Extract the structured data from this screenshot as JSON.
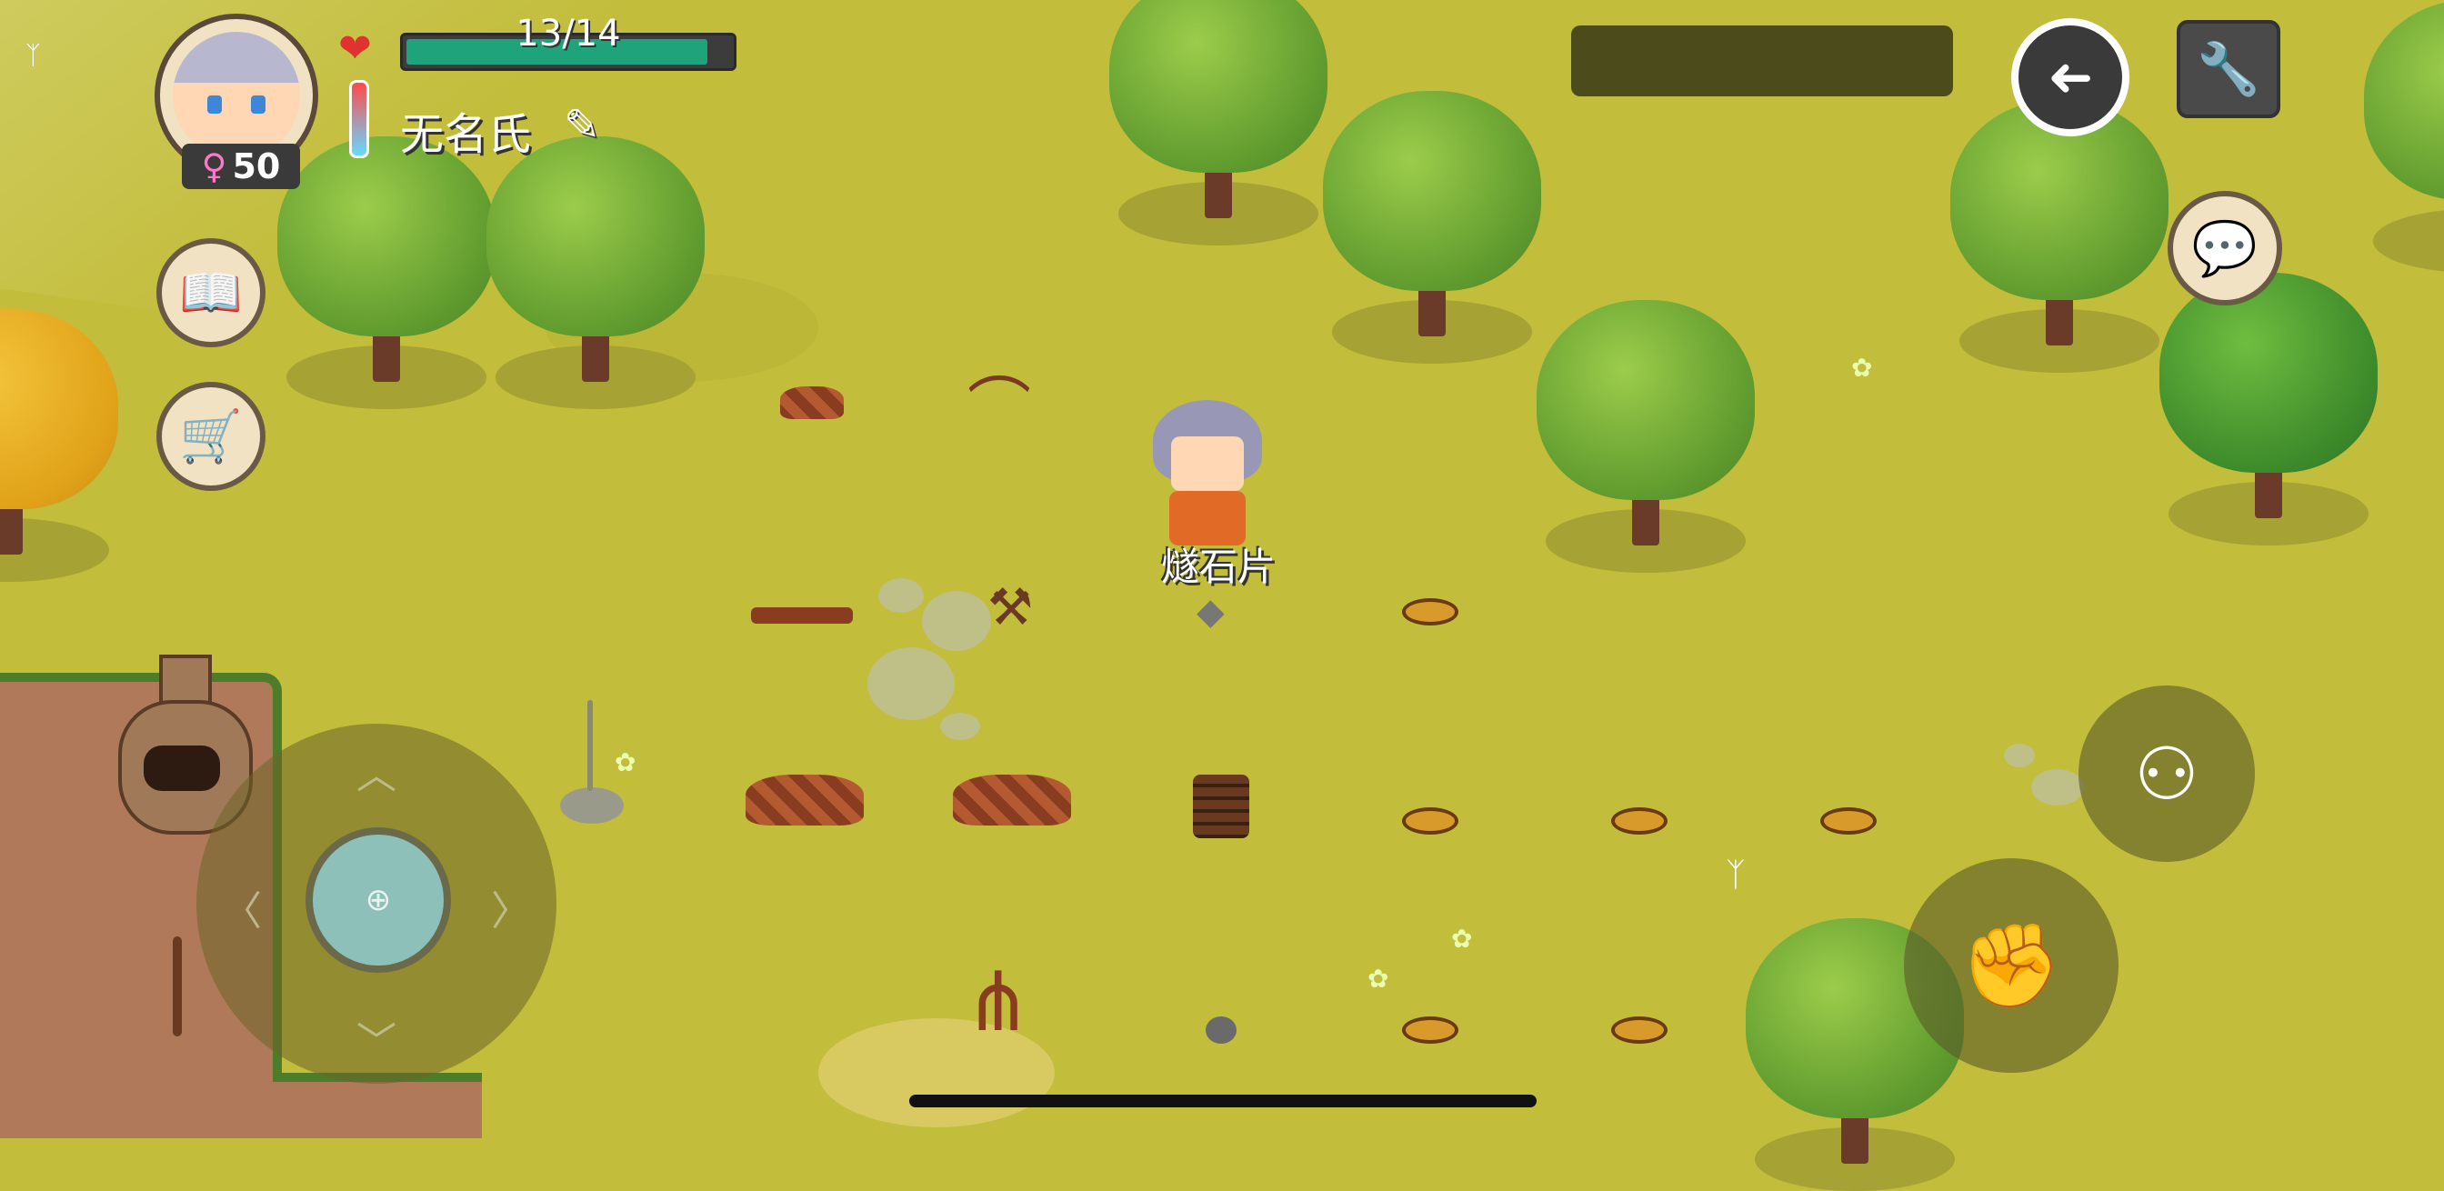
{
  "player": {
    "name": "无名氏",
    "gender_symbol": "♀",
    "age": "50",
    "hp_text": "13/14",
    "hp_current": 13,
    "hp_max": 14
  },
  "world": {
    "held_item_label": "燧石片"
  },
  "icons": {
    "heart": "❤",
    "pencil": "✎",
    "journal": "📖",
    "cart": "🛒",
    "back": "➜",
    "wrench": "🔧",
    "chat": "💬",
    "joystick_center": "⊕",
    "arrow_up": "︿",
    "arrow_down": "﹀",
    "arrow_left": "〈",
    "arrow_right": "〉",
    "tree_action": "⚇",
    "grab_action": "✊",
    "butterfly": "ᛉ",
    "flower": "✿"
  },
  "colors": {
    "grass": "#c2bd3b",
    "hp_fill": "#1fa37b",
    "heart": "#e0322e",
    "gender": "#ff77c9"
  }
}
